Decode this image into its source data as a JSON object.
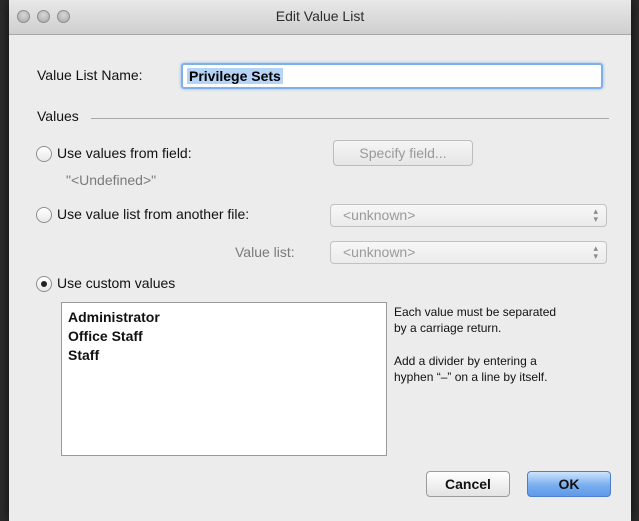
{
  "window": {
    "title": "Edit Value List"
  },
  "name_field": {
    "label": "Value List Name:",
    "value": "Privilege Sets"
  },
  "values_section": {
    "label": "Values"
  },
  "option_field": {
    "label": "Use values from field:",
    "button": "Specify field...",
    "undefined_text": "\"<Undefined>\"",
    "selected": false
  },
  "option_file": {
    "label": "Use value list from another file:",
    "file_popup": "<unknown>",
    "value_list_label": "Value list:",
    "value_list_popup": "<unknown>",
    "selected": false
  },
  "option_custom": {
    "label": "Use custom values",
    "selected": true
  },
  "custom_values": [
    "Administrator",
    "Office Staff",
    "Staff"
  ],
  "help": {
    "line1": "Each value must be separated",
    "line2": "by a carriage return.",
    "line3": "Add a divider by entering a",
    "line4": "hyphen “–” on a line by itself."
  },
  "buttons": {
    "cancel": "Cancel",
    "ok": "OK"
  }
}
